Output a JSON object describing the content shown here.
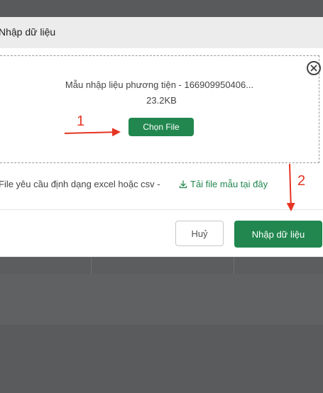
{
  "modal": {
    "title": "Nhập dữ liệu",
    "file_name": "Mẫu nhập liệu phương tiện - 166909950406...",
    "file_size": "23.2KB",
    "choose_file_label": "Chọn File",
    "hint": "File yêu cầu định dạng excel hoặc csv -",
    "download_template_label": "Tải file mẫu tại đây",
    "cancel_label": "Huỷ",
    "submit_label": "Nhập dữ liệu"
  },
  "annotations": {
    "step1": "1",
    "step2": "2",
    "color": "#e53422"
  },
  "icons": [
    "close-circle-icon",
    "download-icon"
  ],
  "colors": {
    "primary": "#21874f",
    "header_bg": "#ececec",
    "overlay": "#5f6062"
  }
}
